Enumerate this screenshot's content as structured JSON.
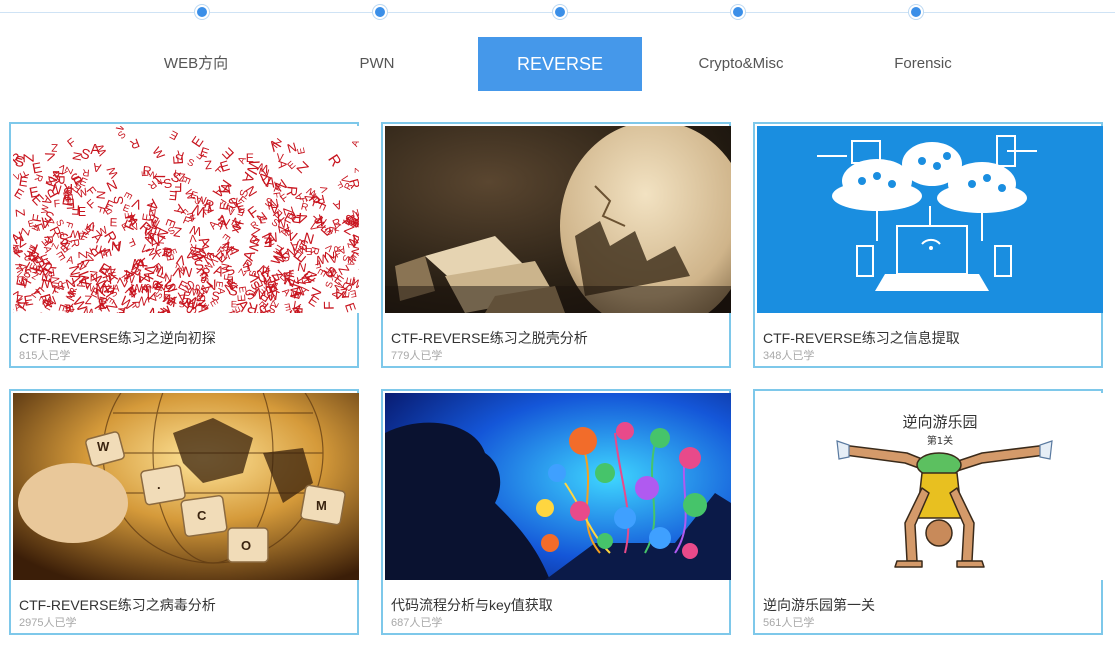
{
  "tabs": [
    {
      "label": "WEB方向"
    },
    {
      "label": "PWN"
    },
    {
      "label": "REVERSE",
      "active": true
    },
    {
      "label": "Crypto&Misc"
    },
    {
      "label": "Forensic"
    }
  ],
  "colors": {
    "accent": "#4598ea",
    "card_border": "#7ec8ea",
    "count_text": "#a8a8a8"
  },
  "courses": [
    {
      "title": "CTF-REVERSE练习之逆向初探",
      "learners": "815人已学",
      "image": "red-letters"
    },
    {
      "title": "CTF-REVERSE练习之脱壳分析",
      "learners": "779人已学",
      "image": "cracked-egg"
    },
    {
      "title": "CTF-REVERSE练习之信息提取",
      "learners": "348人已学",
      "image": "cloud-network"
    },
    {
      "title": "CTF-REVERSE练习之病毒分析",
      "learners": "2975人已学",
      "image": "globe-keyboard"
    },
    {
      "title": "代码流程分析与key值获取",
      "learners": "687人已学",
      "image": "social-icons"
    },
    {
      "title": "逆向游乐园第一关",
      "learners": "561人已学",
      "image": "handstand-cartoon",
      "image_text": {
        "title": "逆向游乐园",
        "subtitle": "第1关"
      }
    }
  ]
}
